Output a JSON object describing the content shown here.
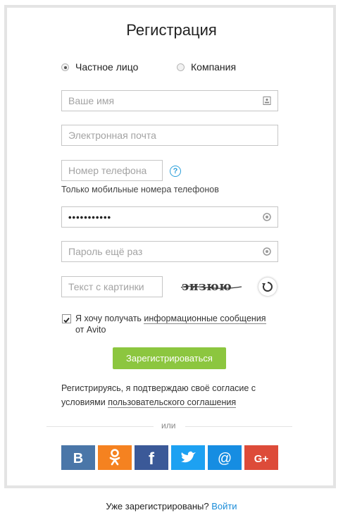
{
  "page": {
    "title": "Регистрация",
    "account_types": [
      {
        "label": "Частное лицо",
        "selected": true
      },
      {
        "label": "Компания",
        "selected": false
      }
    ],
    "fields": {
      "name_placeholder": "Ваше имя",
      "email_placeholder": "Электронная почта",
      "phone_placeholder": "Номер телефона",
      "phone_hint": "Только мобильные номера телефонов",
      "password_value": "•••••••••••",
      "password_repeat_placeholder": "Пароль ещё раз",
      "captcha_placeholder": "Текст с картинки",
      "captcha_text": "эизюю"
    },
    "newsletter": {
      "checked": true,
      "text_before": "Я хочу получать ",
      "link_text": "информационные сообщения",
      "text_after": "от Avito"
    },
    "register_button": "Зарегистрироваться",
    "agreement": {
      "text_line1": "Регистрируясь, я подтверждаю своё согласие с",
      "text_line2": "условиями ",
      "link_text": "пользовательского соглашения"
    },
    "or_label": "или",
    "social": [
      {
        "name": "vk",
        "label": "В",
        "color": "#4a76a8"
      },
      {
        "name": "odnoklassniki",
        "label": "ok",
        "color": "#f58220"
      },
      {
        "name": "facebook",
        "label": "f",
        "color": "#3b5998"
      },
      {
        "name": "twitter",
        "label": "t",
        "color": "#1da1f2"
      },
      {
        "name": "mailru",
        "label": "@",
        "color": "#168de2"
      },
      {
        "name": "google-plus",
        "label": "G+",
        "color": "#dd4b39"
      }
    ],
    "footer": {
      "question": "Уже зарегистрированы? ",
      "login_link": "Войти"
    }
  }
}
